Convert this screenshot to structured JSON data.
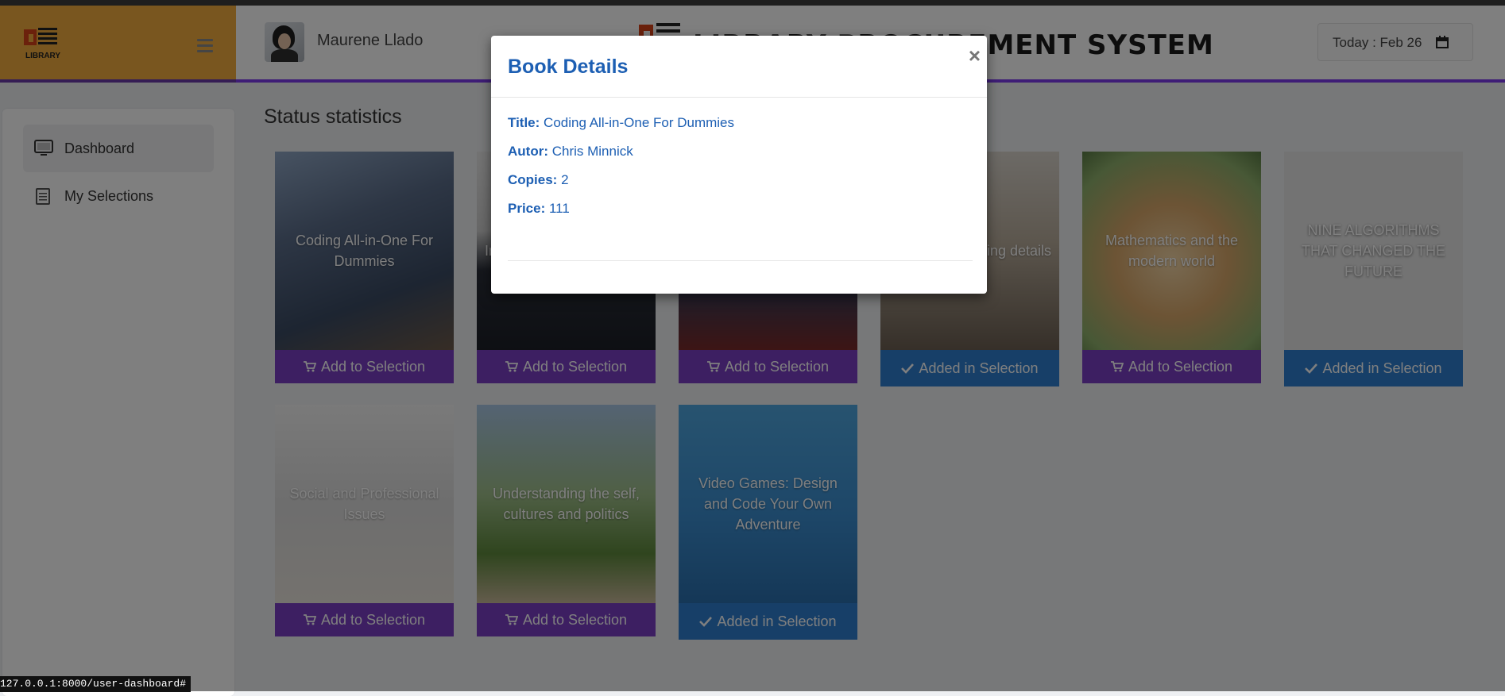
{
  "header": {
    "brand_logo_text": "LIBRARY",
    "user_name": "Maurene Llado",
    "site_title": "LIBRARY PROCUREMENT SYSTEM",
    "today_label": "Today : Feb 26"
  },
  "sidebar": {
    "items": [
      {
        "label": "Dashboard",
        "active": true,
        "icon": "monitor-icon"
      },
      {
        "label": "My Selections",
        "active": false,
        "icon": "list-icon"
      }
    ]
  },
  "main": {
    "heading": "Status statistics",
    "books": [
      {
        "title": "Coding All-in-One For Dummies",
        "button": "Add to Selection",
        "state": "add"
      },
      {
        "title": "In",
        "button": "Add to Selection",
        "state": "add"
      },
      {
        "title": "",
        "button": "Add to Selection",
        "state": "add"
      },
      {
        "title": "ing details",
        "button": "Added in Selection",
        "state": "added"
      },
      {
        "title": "Mathematics and the modern world",
        "button": "Add to Selection",
        "state": "add"
      },
      {
        "title": "NINE ALGORITHMS THAT CHANGED THE FUTURE",
        "button": "Added in Selection",
        "state": "added"
      },
      {
        "title": "Social and Professional Issues",
        "button": "Add to Selection",
        "state": "add"
      },
      {
        "title": "Understanding the self, cultures and politics",
        "button": "Add to Selection",
        "state": "add"
      },
      {
        "title": "Video Games: Design and Code Your Own Adventure",
        "button": "Added in Selection",
        "state": "added"
      }
    ]
  },
  "modal": {
    "title": "Book Details",
    "close": "×",
    "fields": [
      {
        "label": "Title:",
        "value": "Coding All-in-One For Dummies"
      },
      {
        "label": "Autor:",
        "value": "Chris Minnick"
      },
      {
        "label": "Copies:",
        "value": "2"
      },
      {
        "label": "Price:",
        "value": "111"
      }
    ]
  },
  "statusbar": {
    "url": "127.0.0.1:8000/user-dashboard#"
  },
  "colors": {
    "brand": "#f2ac3e",
    "accent_purple": "#7b3fc4",
    "added_blue": "#2f7fd0",
    "modal_text": "#1d5fb3"
  }
}
